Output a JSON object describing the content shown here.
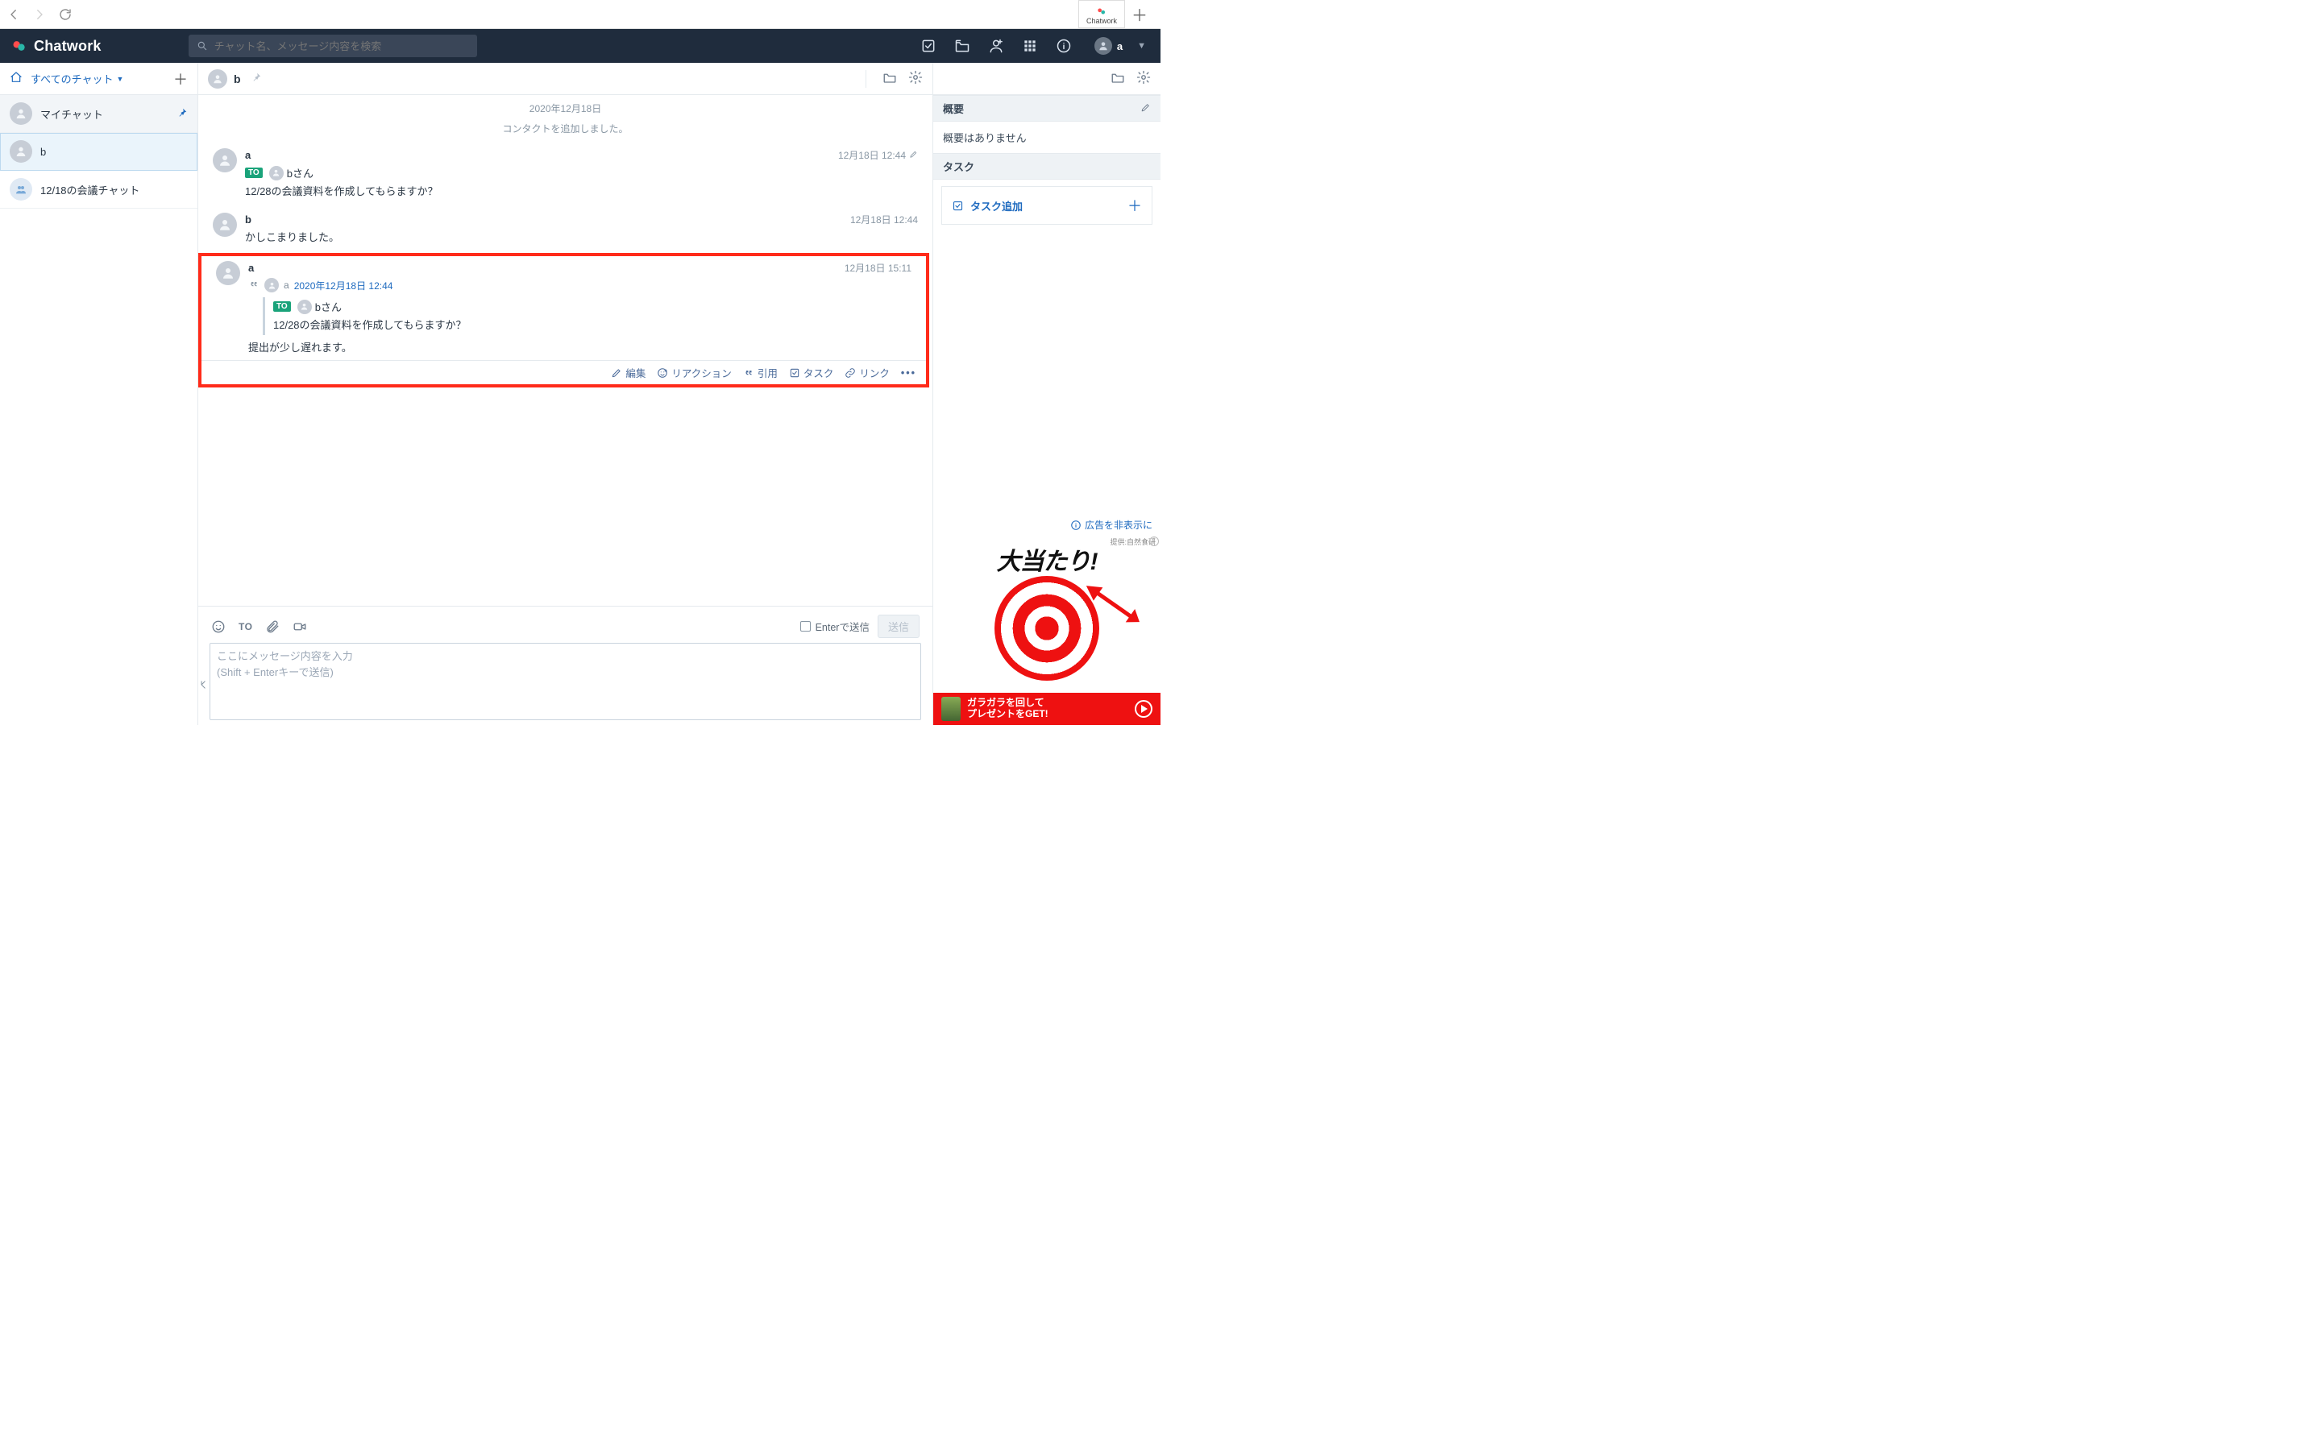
{
  "browser": {
    "tab_label": "Chatwork"
  },
  "appbar": {
    "brand": "Chatwork",
    "search_placeholder": "チャット名、メッセージ内容を検索",
    "user_name": "a"
  },
  "sidebar": {
    "filter_label": "すべてのチャット",
    "items": [
      {
        "label": "マイチャット",
        "pinned": true
      },
      {
        "label": "b",
        "active": true
      },
      {
        "label": "12/18の会議チャット",
        "group": true
      }
    ]
  },
  "room": {
    "name": "b"
  },
  "timeline": {
    "date": "2020年12月18日",
    "system_msg": "コンタクトを追加しました。",
    "messages": [
      {
        "sender": "a",
        "ts": "12月18日 12:44",
        "edited": true,
        "to_name": "bさん",
        "text": "12/28の会議資料を作成してもらますか？"
      },
      {
        "sender": "b",
        "ts": "12月18日 12:44",
        "text": "かしこまりました。"
      },
      {
        "sender": "a",
        "ts": "12月18日 15:11",
        "quote": {
          "name": "a",
          "datetime": "2020年12月18日 12:44",
          "to_name": "bさん",
          "text": "12/28の会議資料を作成してもらますか？"
        },
        "text": "提出が少し遅れます。"
      }
    ],
    "hover_actions": {
      "edit": "編集",
      "reaction": "リアクション",
      "quote": "引用",
      "task": "タスク",
      "link": "リンク"
    }
  },
  "composer": {
    "to_label": "TO",
    "enter_send": "Enterで送信",
    "send": "送信",
    "placeholder": "ここにメッセージ内容を入力\n(Shift + Enterキーで送信)"
  },
  "rightpanel": {
    "overview_h": "概要",
    "overview_body": "概要はありません",
    "task_h": "タスク",
    "task_add": "タスク追加",
    "ad_hide": "広告を非表示に",
    "ad_title": "大当たり!",
    "ad_provider": "提供:自然食研",
    "ad_line1": "ガラガラを回して",
    "ad_line2": "プレゼントをGET!"
  }
}
